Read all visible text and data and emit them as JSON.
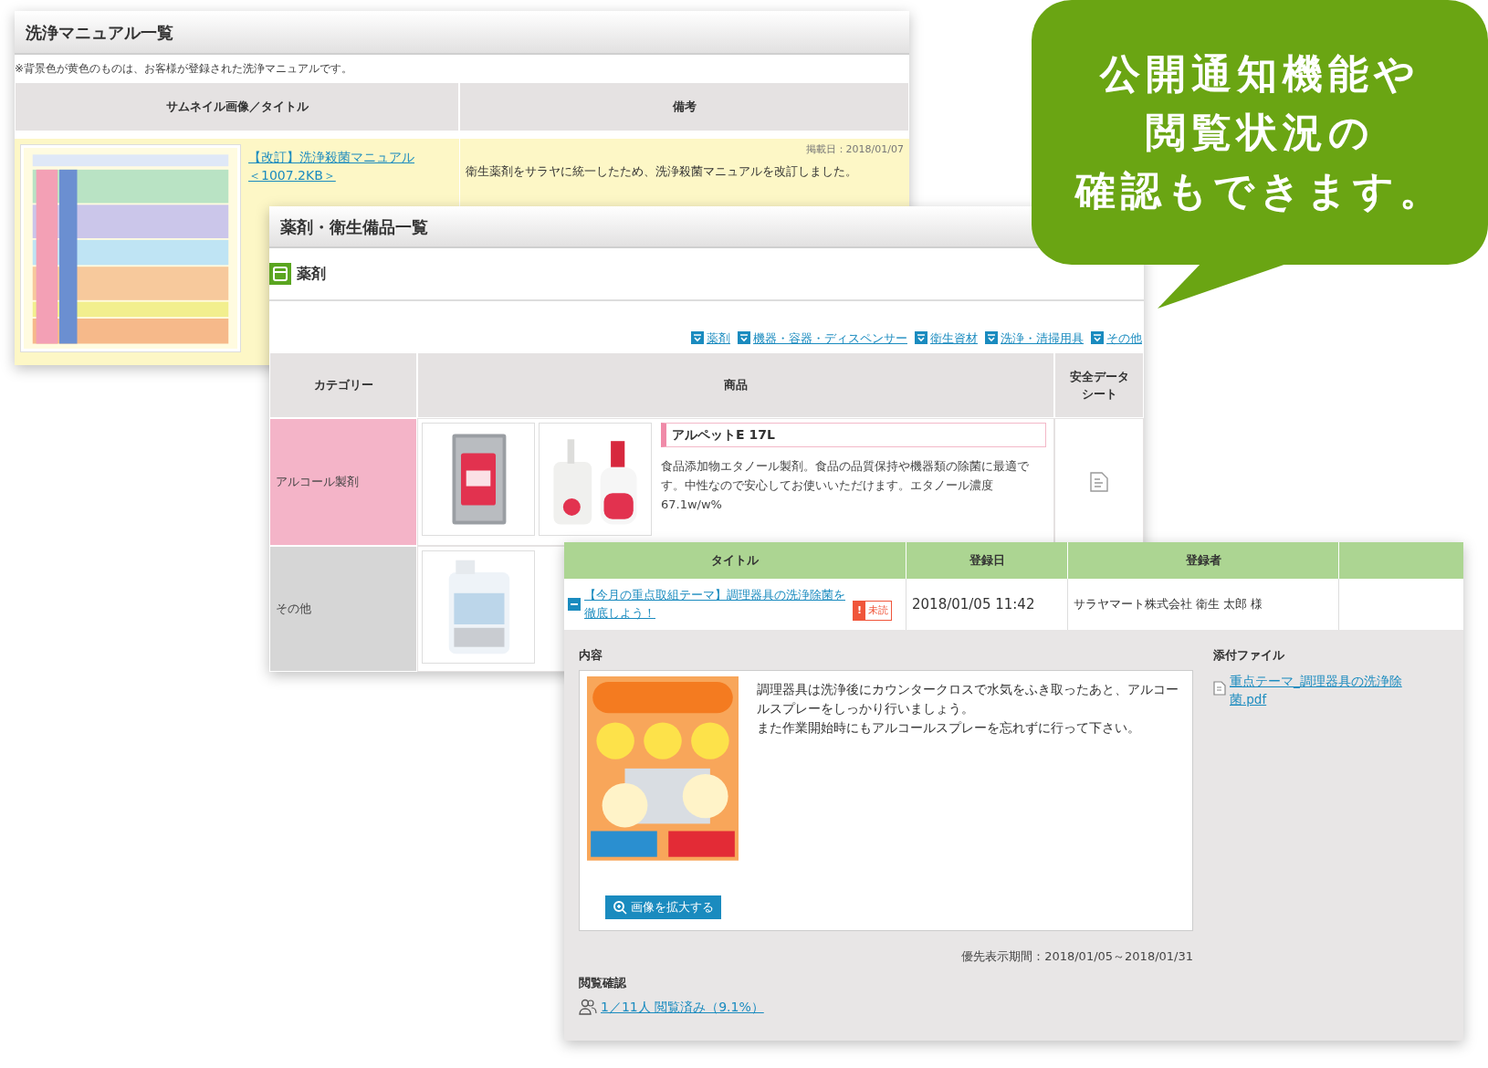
{
  "manual_panel": {
    "title": "洗浄マニュアル一覧",
    "note": "※背景色が黄色のものは、お客様が登録された洗浄マニュアルです。",
    "columns": [
      "サムネイル画像／タイトル",
      "備考"
    ],
    "rows": [
      {
        "thumbnail": {
          "kind": "picture"
        },
        "link": "【改訂】洗浄殺菌マニュアル",
        "size": "＜1007.2KB＞",
        "posted": "掲載日：2018/01/07",
        "remark": "衛生薬剤をサラヤに統一したため、洗浄殺菌マニュアルを改訂しました。"
      }
    ]
  },
  "supplies_panel": {
    "title": "薬剤・衛生備品一覧",
    "section": "薬剤",
    "nav_links": [
      "薬剤",
      "機器・容器・ディスペンサー",
      "衛生資材",
      "洗浄・清掃用具",
      "その他"
    ],
    "columns": [
      "カテゴリー",
      "商品",
      "安全データシート"
    ],
    "rows": [
      {
        "category": "アルコール製剤",
        "color": "#f4b4c8",
        "images": [
          {
            "kind": "picture"
          },
          {
            "kind": "picture"
          }
        ],
        "name": "アルペットE 17L",
        "description": "食品添加物エタノール製剤。食品の品質保持や機器類の除菌に最適です。中性なので安心してお使いいただけます。エタノール濃度67.1w/w%",
        "sds": true
      },
      {
        "category": "その他",
        "color": "#d6d6d6",
        "images": [
          {
            "kind": "picture"
          }
        ]
      }
    ]
  },
  "notice_panel": {
    "columns": [
      "タイトル",
      "登録日",
      "登録者"
    ],
    "row": {
      "expanded": true,
      "title": "【今月の重点取組テーマ】調理器具の洗浄除菌を徹底しよう！",
      "unread_icon": "!",
      "unread": "未読",
      "date": "2018/01/05 11:42",
      "author": "サラヤマート株式会社 衛生 太郎 様"
    },
    "content_label": "内容",
    "image": {
      "kind": "picture"
    },
    "enlarge_button": "画像を拡大する",
    "body": [
      "調理器具は洗浄後にカウンタークロスで水気をふき取ったあと、アルコールスプレーをしっかり行いましょう。",
      "また作業開始時にもアルコールスプレーを忘れずに行って下さい。"
    ],
    "attachments_label": "添付ファイル",
    "attachment": "重点テーマ_調理器具の洗浄除菌.pdf",
    "period": "優先表示期間：2018/01/05～2018/01/31",
    "read_label": "閲覧確認",
    "read_link": "1／11人 閲覧済み（9.1%）"
  },
  "callout": {
    "lines": [
      "公開通知機能や",
      "閲覧状況の",
      "確認もできます。"
    ]
  }
}
